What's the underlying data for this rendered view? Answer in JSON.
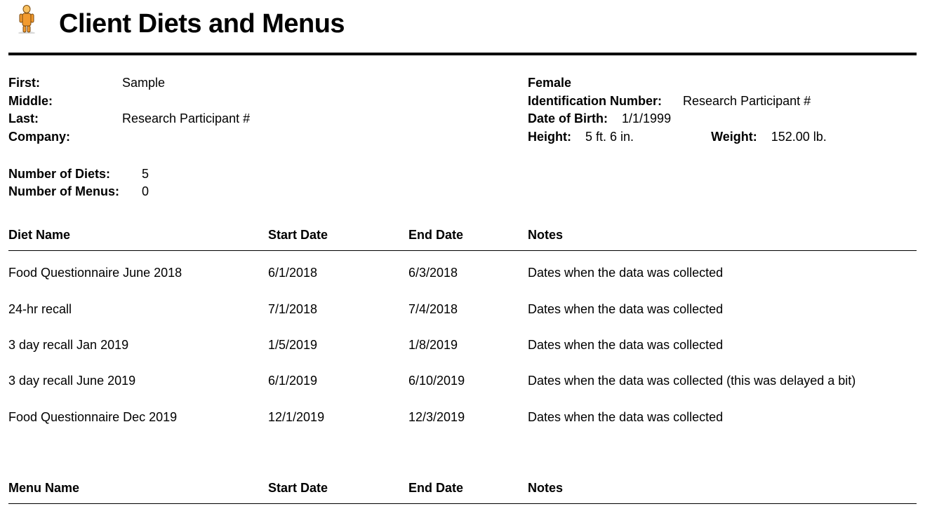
{
  "title": "Client Diets and Menus",
  "client": {
    "labels": {
      "first": "First:",
      "middle": "Middle:",
      "last": "Last:",
      "company": "Company:",
      "identification": "Identification Number:",
      "dob": "Date of Birth:",
      "height": "Height:",
      "weight": "Weight:"
    },
    "first": "Sample",
    "middle": "",
    "last": "Research Participant #",
    "company": "",
    "gender": "Female",
    "identification": "Research Participant #",
    "dob": "1/1/1999",
    "height": "5 ft. 6 in.",
    "weight": "152.00 lb."
  },
  "counts": {
    "labels": {
      "diets": "Number of Diets:",
      "menus": "Number of Menus:"
    },
    "diets": "5",
    "menus": "0"
  },
  "dietTable": {
    "headers": {
      "name": "Diet Name",
      "start": "Start Date",
      "end": "End Date",
      "notes": "Notes"
    },
    "rows": [
      {
        "name": "Food Questionnaire June 2018",
        "start": "6/1/2018",
        "end": "6/3/2018",
        "notes": "Dates when the data was collected"
      },
      {
        "name": "24-hr recall",
        "start": "7/1/2018",
        "end": "7/4/2018",
        "notes": "Dates when the data was collected"
      },
      {
        "name": "3 day recall Jan 2019",
        "start": "1/5/2019",
        "end": "1/8/2019",
        "notes": "Dates when the data was collected"
      },
      {
        "name": "3 day recall June 2019",
        "start": "6/1/2019",
        "end": "6/10/2019",
        "notes": "Dates when the data was collected (this was delayed a bit)"
      },
      {
        "name": "Food Questionnaire Dec 2019",
        "start": "12/1/2019",
        "end": "12/3/2019",
        "notes": "Dates when the data was collected"
      }
    ]
  },
  "menuTable": {
    "headers": {
      "name": "Menu Name",
      "start": "Start Date",
      "end": "End Date",
      "notes": "Notes"
    },
    "rows": []
  }
}
